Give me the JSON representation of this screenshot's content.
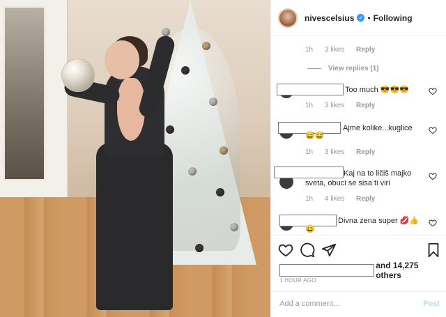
{
  "header": {
    "username": "nivescelsius",
    "separator": "•",
    "follow_status": "Following"
  },
  "comments": [
    {
      "type": "meta",
      "time": "1h",
      "likes": "3 likes",
      "reply": "Reply"
    },
    {
      "type": "view_replies",
      "label": "View replies (1)"
    },
    {
      "text": "Too much 😎😎😎",
      "time": "1h",
      "likes": "3 likes",
      "reply": "Reply"
    },
    {
      "text": "Ajme kolike...kuglice",
      "emoji_line": "😅😅",
      "time": "1h",
      "likes": "3 likes",
      "reply": "Reply"
    },
    {
      "text": "Kaj na to ličiš majko",
      "text2": "sveta, obuci se sisa ti viri",
      "time": "1h",
      "likes": "4 likes",
      "reply": "Reply"
    },
    {
      "text": "Divna zena super 💋👍",
      "emoji_line": "😄"
    }
  ],
  "likes": {
    "suffix": "and 14,275 others"
  },
  "timestamp": "1 HOUR AGO",
  "add_comment": {
    "placeholder": "Add a comment…",
    "post_label": "Post"
  },
  "colors": {
    "link": "#3897f0",
    "post_disabled": "#b2dffc",
    "meta": "#999999",
    "text": "#262626"
  }
}
